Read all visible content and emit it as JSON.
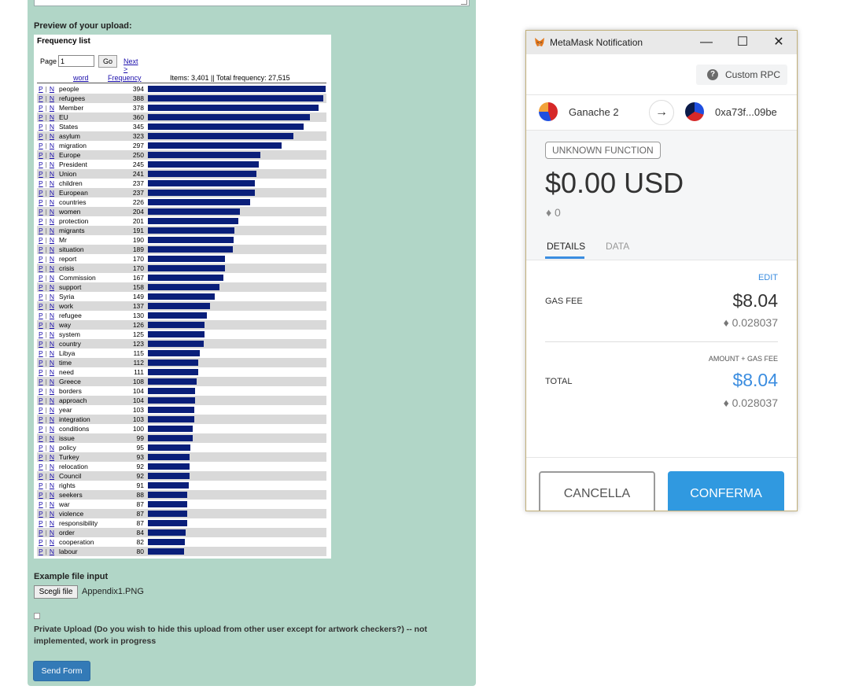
{
  "form": {
    "preview_label": "Preview of your upload:",
    "file_label": "Example file input",
    "file_button": "Scegli file",
    "file_name": "Appendix1.PNG",
    "private_text": "Private Upload (Do you wish to hide this upload from other user except for artwork checkers?) -- not implemented, work in progress",
    "send_button": "Send Form"
  },
  "freq": {
    "title": "Frequency list",
    "page_label": "Page",
    "page_value": "1",
    "go_label": "Go",
    "next_label": "Next >",
    "col_word": "word",
    "col_frequency": "Frequency",
    "stats": "Items: 3,401 || Total frequency: 27,515",
    "pn_p": "P",
    "pn_sep": "|",
    "pn_n": "N",
    "max": 394,
    "rows": [
      {
        "word": "people",
        "count": 394
      },
      {
        "word": "refugees",
        "count": 388
      },
      {
        "word": "Member",
        "count": 378
      },
      {
        "word": "EU",
        "count": 360
      },
      {
        "word": "States",
        "count": 345
      },
      {
        "word": "asylum",
        "count": 323
      },
      {
        "word": "migration",
        "count": 297
      },
      {
        "word": "Europe",
        "count": 250
      },
      {
        "word": "President",
        "count": 245
      },
      {
        "word": "Union",
        "count": 241
      },
      {
        "word": "children",
        "count": 237
      },
      {
        "word": "European",
        "count": 237
      },
      {
        "word": "countries",
        "count": 226
      },
      {
        "word": "women",
        "count": 204
      },
      {
        "word": "protection",
        "count": 201
      },
      {
        "word": "migrants",
        "count": 191
      },
      {
        "word": "Mr",
        "count": 190
      },
      {
        "word": "situation",
        "count": 189
      },
      {
        "word": "report",
        "count": 170
      },
      {
        "word": "crisis",
        "count": 170
      },
      {
        "word": "Commission",
        "count": 167
      },
      {
        "word": "support",
        "count": 158
      },
      {
        "word": "Syria",
        "count": 149
      },
      {
        "word": "work",
        "count": 137
      },
      {
        "word": "refugee",
        "count": 130
      },
      {
        "word": "way",
        "count": 126
      },
      {
        "word": "system",
        "count": 125
      },
      {
        "word": "country",
        "count": 123
      },
      {
        "word": "Libya",
        "count": 115
      },
      {
        "word": "time",
        "count": 112
      },
      {
        "word": "need",
        "count": 111
      },
      {
        "word": "Greece",
        "count": 108
      },
      {
        "word": "borders",
        "count": 104
      },
      {
        "word": "approach",
        "count": 104
      },
      {
        "word": "year",
        "count": 103
      },
      {
        "word": "integration",
        "count": 103
      },
      {
        "word": "conditions",
        "count": 100
      },
      {
        "word": "issue",
        "count": 99
      },
      {
        "word": "policy",
        "count": 95
      },
      {
        "word": "Turkey",
        "count": 93
      },
      {
        "word": "relocation",
        "count": 92
      },
      {
        "word": "Council",
        "count": 92
      },
      {
        "word": "rights",
        "count": 91
      },
      {
        "word": "seekers",
        "count": 88
      },
      {
        "word": "war",
        "count": 87
      },
      {
        "word": "violence",
        "count": 87
      },
      {
        "word": "responsibility",
        "count": 87
      },
      {
        "word": "order",
        "count": 84
      },
      {
        "word": "cooperation",
        "count": 82
      },
      {
        "word": "labour",
        "count": 80
      }
    ]
  },
  "metamask": {
    "title": "MetaMask Notification",
    "controls": {
      "minimize": "—",
      "maximize": "☐",
      "close": "✕"
    },
    "rpc_label": "Custom RPC",
    "from_name": "Ganache 2",
    "to_address": "0xa73f...09be",
    "function_badge": "UNKNOWN FUNCTION",
    "amount_usd": "$0.00 USD",
    "amount_eth": "♦ 0",
    "tabs": {
      "details": "DETAILS",
      "data": "DATA"
    },
    "edit": "EDIT",
    "gas_label": "GAS FEE",
    "gas_usd": "$8.04",
    "gas_eth": "♦ 0.028037",
    "amount_gas_label": "AMOUNT + GAS FEE",
    "total_label": "TOTAL",
    "total_usd": "$8.04",
    "total_eth": "♦ 0.028037",
    "cancel": "CANCELLA",
    "confirm": "CONFERMA",
    "colors": {
      "accent": "#3099e0",
      "details_underline": "#3b8de0"
    }
  }
}
